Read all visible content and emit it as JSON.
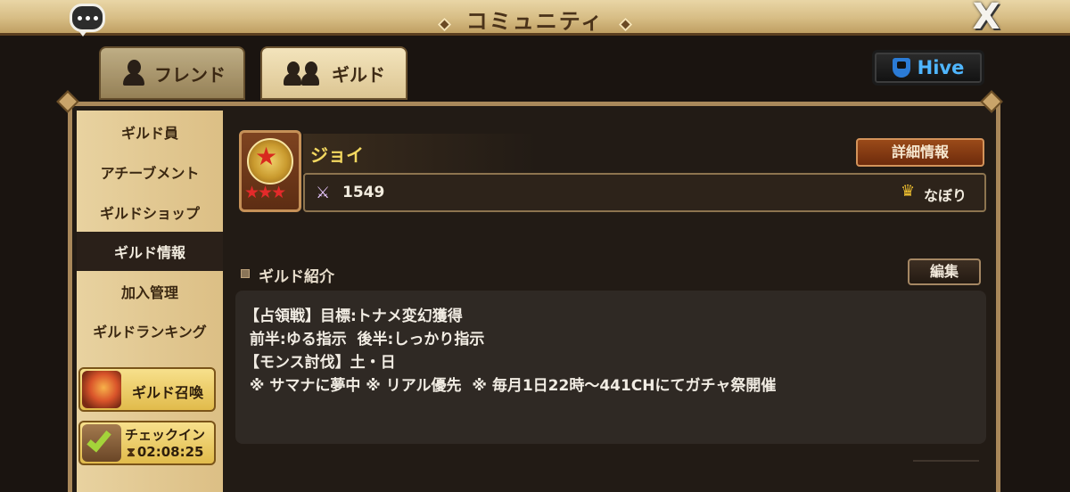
{
  "header": {
    "title": "コミュニティ",
    "close_label": "X"
  },
  "tabs": [
    {
      "label": "フレンド",
      "active": false
    },
    {
      "label": "ギルド",
      "active": true
    }
  ],
  "hive_button": {
    "label": "Hive"
  },
  "sidebar": {
    "items": [
      {
        "label": "ギルド員"
      },
      {
        "label": "アチーブメント"
      },
      {
        "label": "ギルドショップ"
      },
      {
        "label": "ギルド情報",
        "active": true
      },
      {
        "label": "加入管理"
      },
      {
        "label": "ギルドランキング"
      }
    ],
    "summon_button": {
      "label": "ギルド召喚"
    },
    "checkin_button": {
      "label": "チェックイン",
      "timer": "02:08:25"
    }
  },
  "guild": {
    "name": "ジョイ",
    "score": "1549",
    "master_name": "なぼり",
    "detail_button": "詳細情報"
  },
  "intro": {
    "label": "ギルド紹介",
    "edit_button": "編集",
    "lines": [
      "【占領戦】目標:トナメ変幻獲得",
      " 前半:ゆる指示  後半:しっかり指示",
      "【モンス討伐】土・日",
      " ※ サマナに夢中 ※ リアル優先  ※ 毎月1日22時～441CHにてガチャ祭開催"
    ]
  },
  "colors": {
    "accent_gold": "#f3d860",
    "hive_blue": "#4fb6ff",
    "frame_tan": "#a9885a"
  }
}
